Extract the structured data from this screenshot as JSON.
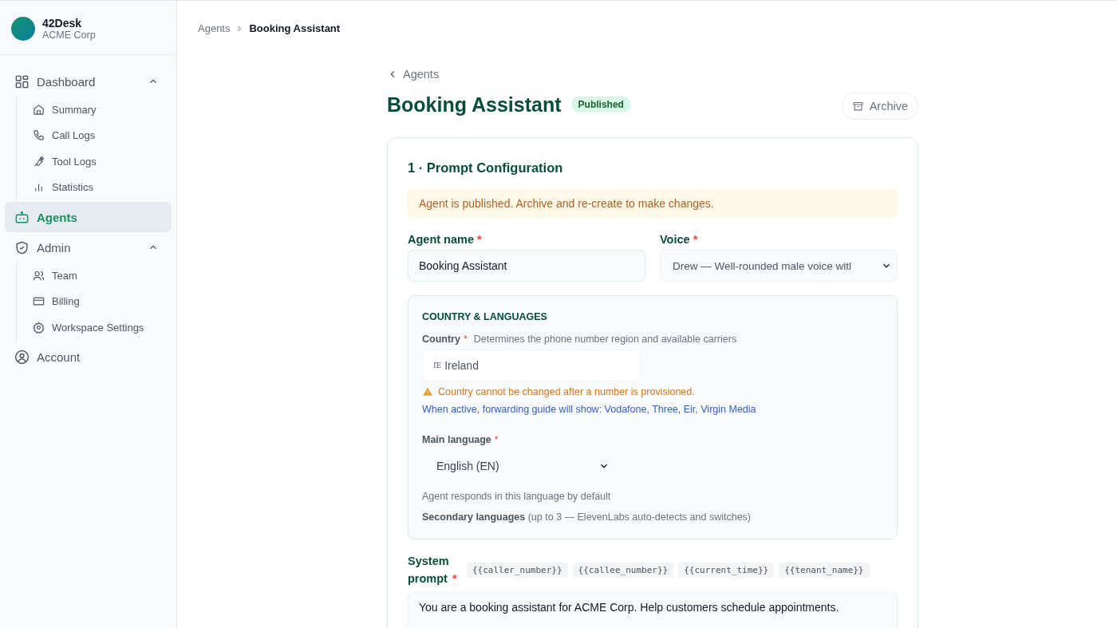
{
  "brand": {
    "name": "42Desk",
    "org": "ACME Corp"
  },
  "sidebar": {
    "items": [
      {
        "label": "Dashboard",
        "selected": false,
        "expanded": true,
        "children": [
          {
            "label": "Summary",
            "selected": false
          },
          {
            "label": "Call Logs",
            "selected": false
          },
          {
            "label": "Tool Logs",
            "selected": false
          },
          {
            "label": "Statistics",
            "selected": false
          }
        ]
      },
      {
        "label": "Agents",
        "selected": true
      },
      {
        "label": "Admin",
        "selected": false,
        "expanded": true,
        "children": [
          {
            "label": "Team",
            "selected": false
          },
          {
            "label": "Billing",
            "selected": false
          },
          {
            "label": "Workspace Settings",
            "selected": false
          }
        ]
      },
      {
        "label": "Account",
        "selected": false
      }
    ]
  },
  "breadcrumb": [
    "Agents",
    "Booking Assistant"
  ],
  "back_link": "Agents",
  "title": "Booking Assistant",
  "status_badge": "Published",
  "archive_button": "Archive",
  "section": {
    "title": "1 · Prompt Configuration",
    "notice": "Agent is published. Archive and re-create to make changes.",
    "agent_name": {
      "label": "Agent name",
      "required_mark": "*",
      "value": "Booking Assistant"
    },
    "voice": {
      "label": "Voice",
      "required_mark": "*",
      "value": "Drew — Well-rounded male voice witl"
    },
    "country_panel": {
      "heading": "COUNTRY & LANGUAGES",
      "country": {
        "label": "Country",
        "required_mark": "*",
        "hint": "Determines the phone number region and available carriers",
        "flag": "IE",
        "value": "Ireland"
      },
      "warning": "Country cannot be changed after a number is provisioned.",
      "info": "When active, forwarding guide will show: Vodafone, Three, Eir, Virgin Media",
      "main_language": {
        "label": "Main language",
        "required_mark": "*",
        "value": "English (EN)",
        "hint": "Agent responds in this language by default"
      },
      "secondary_languages": "**Secondary languages** (up to 3 — ElevenLabs auto-detects and switches)"
    },
    "system_prompt": {
      "label": "System prompt",
      "required_mark": "*",
      "variables": [
        "{{caller_number}}",
        "{{callee_number}}",
        "{{current_time}}",
        "{{tenant_name}}"
      ],
      "value": "You are a booking assistant for ACME Corp. Help customers schedule appointments."
    }
  }
}
